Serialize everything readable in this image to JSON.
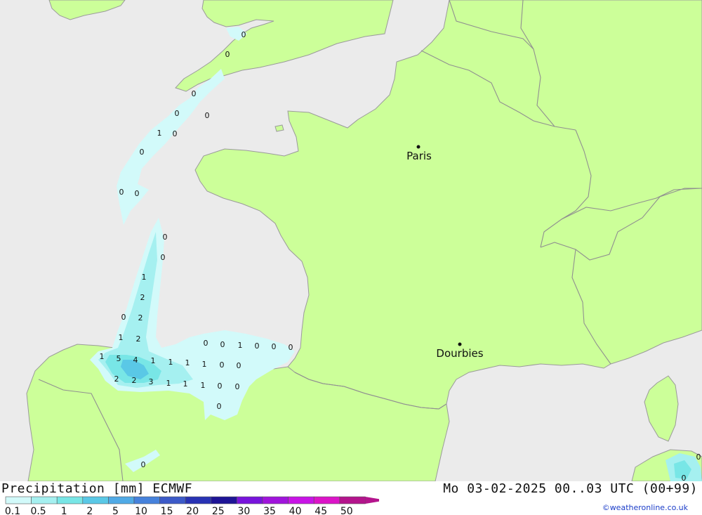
{
  "colors": {
    "sea": "#ebebeb",
    "land": "#ccff99",
    "border": "#909090",
    "coast": "#9a9a9a"
  },
  "cities": [
    {
      "name": "Paris"
    },
    {
      "name": "Dourbies"
    }
  ],
  "precip_labels": [
    "0",
    "0",
    "0",
    "0",
    "0",
    "1",
    "0",
    "0",
    "0",
    "0",
    "0",
    "0",
    "1",
    "2",
    "0",
    "2",
    "1",
    "2",
    "1",
    "5",
    "4",
    "1",
    "1",
    "1",
    "1",
    "0",
    "0",
    "2",
    "2",
    "3",
    "1",
    "1",
    "1",
    "0",
    "0",
    "0",
    "0",
    "0",
    "1",
    "0",
    "0",
    "0",
    "0",
    "0",
    "0"
  ],
  "footer": {
    "title": "Precipitation [mm] ECMWF",
    "datetime": "Mo 03-02-2025 00..03 UTC (00+99)",
    "credit": "©weatheronline.co.uk"
  },
  "legend": {
    "ticks": [
      "0.1",
      "0.5",
      "1",
      "2",
      "5",
      "10",
      "15",
      "20",
      "25",
      "30",
      "35",
      "40",
      "45",
      "50"
    ],
    "colors": [
      "#d2fafa",
      "#a5f0f0",
      "#78e6e6",
      "#5ac8e6",
      "#50aae6",
      "#4682dc",
      "#3c5ac8",
      "#2832b4",
      "#1e1496",
      "#7814dc",
      "#a014dc",
      "#c814e6",
      "#dc14c8",
      "#b4148c"
    ]
  }
}
